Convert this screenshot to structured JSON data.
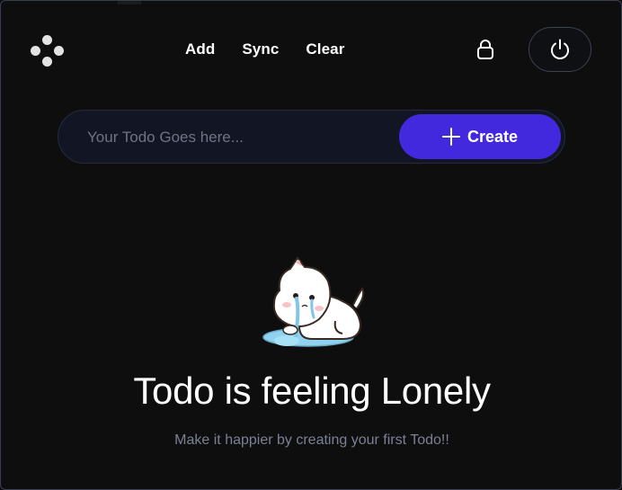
{
  "nav": {
    "items": [
      {
        "label": "Add"
      },
      {
        "label": "Sync"
      },
      {
        "label": "Clear"
      }
    ]
  },
  "icons": {
    "logo": "four-dots-logo-icon",
    "lock": "lock-icon",
    "power": "power-icon",
    "plus": "plus-icon"
  },
  "input": {
    "placeholder": "Your Todo Goes here...",
    "value": ""
  },
  "create_button": {
    "label": "Create"
  },
  "empty_state": {
    "title": "Todo is feeling Lonely",
    "subtitle": "Make it happier by creating your first Todo!!"
  },
  "colors": {
    "background": "#0e0e0f",
    "accent": "#4329dd",
    "input_bg": "#121624",
    "muted_text": "#7b8194"
  }
}
